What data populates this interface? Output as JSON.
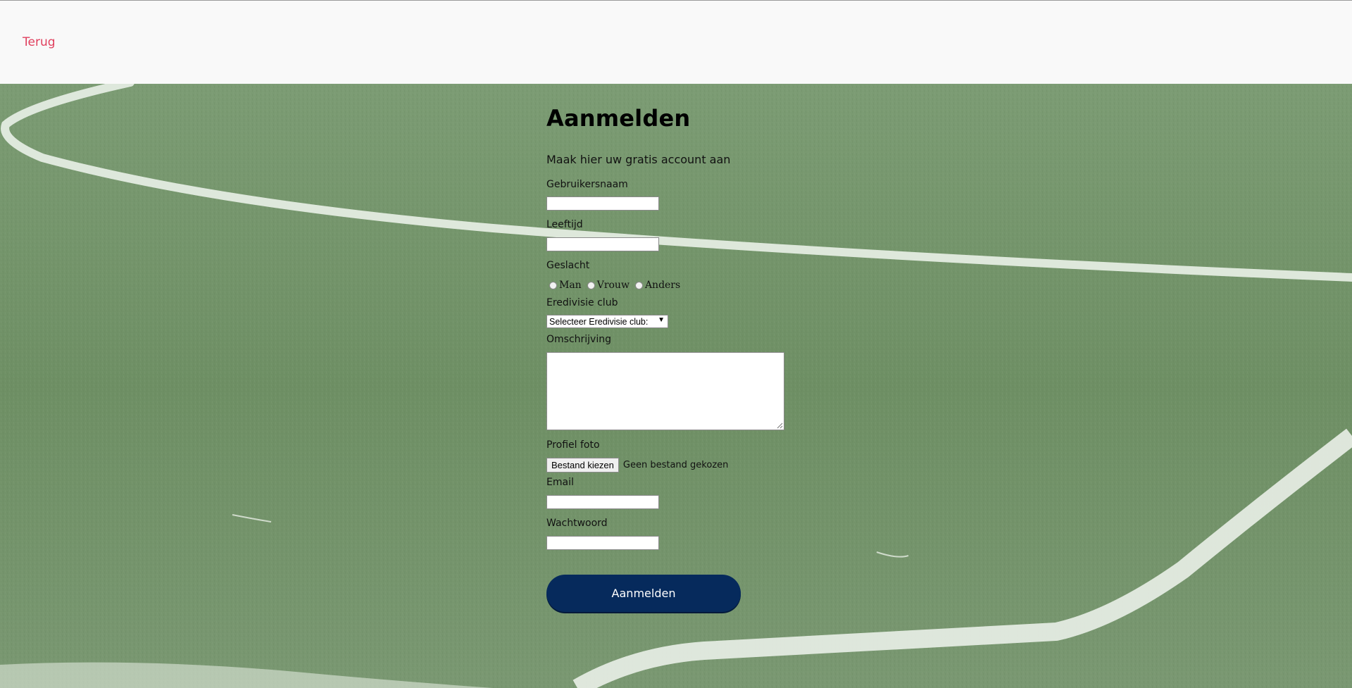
{
  "nav": {
    "back_label": "Terug"
  },
  "form": {
    "title": "Aanmelden",
    "subtitle": "Maak hier uw gratis account aan",
    "username": {
      "label": "Gebruikersnaam",
      "value": ""
    },
    "age": {
      "label": "Leeftijd",
      "value": ""
    },
    "gender": {
      "label": "Geslacht",
      "options": [
        "Man",
        "Vrouw",
        "Anders"
      ]
    },
    "club": {
      "label": "Eredivisie club",
      "selected": "Selecteer Eredivisie club:"
    },
    "description": {
      "label": "Omschrijving",
      "value": ""
    },
    "photo": {
      "label": "Profiel foto",
      "button": "Bestand kiezen",
      "status": "Geen bestand gekozen"
    },
    "email": {
      "label": "Email",
      "value": ""
    },
    "password": {
      "label": "Wachtwoord",
      "value": ""
    },
    "submit_label": "Aanmelden"
  },
  "colors": {
    "back_link": "#e0405e",
    "submit_bg": "#062a5c",
    "header_bg": "#f9f9f9",
    "grass": "#6f9065"
  }
}
